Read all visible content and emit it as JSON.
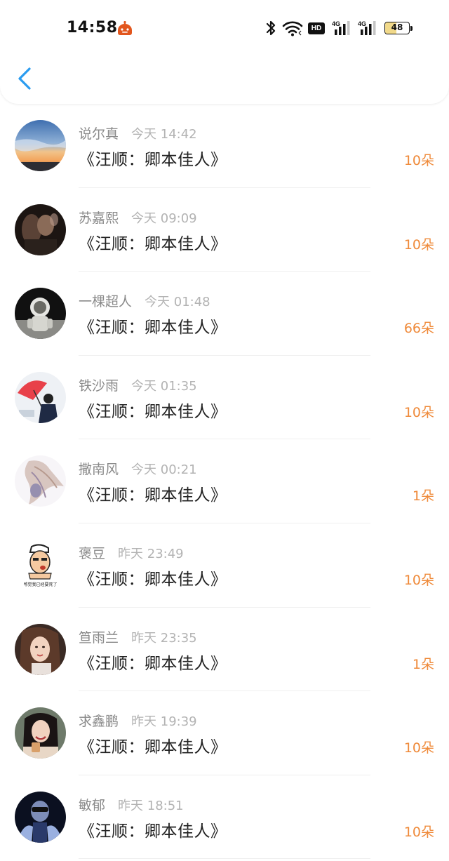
{
  "status_bar": {
    "time": "14:58",
    "hd_label": "HD",
    "signal_1_label": "4G",
    "signal_2_label": "4G",
    "battery_level": "48",
    "battery_fraction": 0.48,
    "icons": [
      "app-notification-icon",
      "bluetooth-icon",
      "wifi-icon",
      "hd-voice-icon",
      "signal-icon",
      "signal-icon",
      "battery-icon"
    ]
  },
  "nav": {
    "back_icon": "chevron-left-icon",
    "accent_color": "#2a9cf0"
  },
  "colors": {
    "amount": "#ef8a3a",
    "name": "#8a8a8a",
    "time": "#b3b3b3",
    "title": "#222222"
  },
  "items": [
    {
      "name": "说尔真",
      "time": "今天 14:42",
      "title": "《汪顺：卿本佳人》",
      "amount": "10朵"
    },
    {
      "name": "苏嘉熙",
      "time": "今天 09:09",
      "title": "《汪顺：卿本佳人》",
      "amount": "10朵"
    },
    {
      "name": "一棵超人",
      "time": "今天 01:48",
      "title": "《汪顺：卿本佳人》",
      "amount": "66朵"
    },
    {
      "name": "铁沙雨",
      "time": "今天 01:35",
      "title": "《汪顺：卿本佳人》",
      "amount": "10朵"
    },
    {
      "name": "撒南风",
      "time": "今天 00:21",
      "title": "《汪顺：卿本佳人》",
      "amount": "1朵"
    },
    {
      "name": "褒豆",
      "time": "昨天 23:49",
      "title": "《汪顺：卿本佳人》",
      "amount": "10朵",
      "avatar_caption": "感觉我已经要死了"
    },
    {
      "name": "笪雨兰",
      "time": "昨天 23:35",
      "title": "《汪顺：卿本佳人》",
      "amount": "1朵"
    },
    {
      "name": "求鑫鹏",
      "time": "昨天 19:39",
      "title": "《汪顺：卿本佳人》",
      "amount": "10朵"
    },
    {
      "name": "敏郁",
      "time": "昨天 18:51",
      "title": "《汪顺：卿本佳人》",
      "amount": "10朵"
    }
  ]
}
